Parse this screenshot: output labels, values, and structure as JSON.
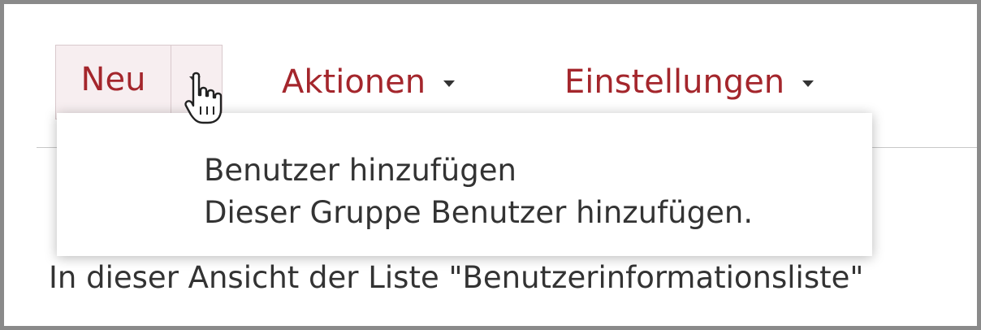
{
  "toolbar": {
    "new_label": "Neu",
    "actions_label": "Aktionen",
    "settings_label": "Einstellungen"
  },
  "dropdown": {
    "items": [
      "Benutzer hinzufügen",
      "Dieser Gruppe Benutzer hinzufügen."
    ]
  },
  "view_message": "In dieser Ansicht der Liste \"Benutzerinformationsliste\"",
  "icons": {
    "new_dropdown": "chevron-down-icon",
    "actions_dropdown": "chevron-down-icon",
    "settings_dropdown": "chevron-down-icon",
    "cursor": "hand-pointer-icon"
  },
  "colors": {
    "accent": "#a4262c",
    "text": "#333333",
    "split_button_bg": "#f7eef0"
  }
}
